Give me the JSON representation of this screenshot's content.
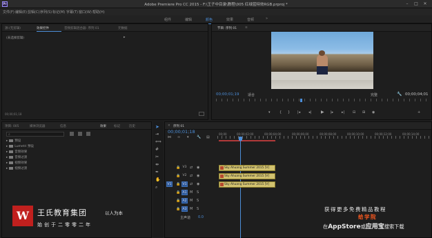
{
  "window": {
    "title": "Adobe Premiere Pro CC 2015 - F:\\王子中目录\\教程\\005 红绿蓝特效RGB.prproj *",
    "app_icon": "Pr"
  },
  "menubar": [
    "文件(F)",
    "编辑(E)",
    "剪辑(C)",
    "序列(S)",
    "标记(M)",
    "字幕(T)",
    "窗口(W)",
    "帮助(H)"
  ],
  "workspace": {
    "tabs": [
      "组件",
      "编辑",
      "颜色",
      "效果",
      "音频"
    ],
    "active_index": 2
  },
  "source_panel": {
    "tabs": [
      "源:(无剪辑)",
      "效果控件",
      "音频剪辑混合器: 序列 01",
      "元数据"
    ],
    "active_index": 1,
    "row_label": "(未选择剪辑)",
    "row_arrow": "▸"
  },
  "program_panel": {
    "tab": "节目: 序列 01",
    "menu_icon": "≡",
    "timecode_left": "00;00;01;19",
    "fit": "适合",
    "quality": "完整",
    "timecode_right": "00;00;04;01"
  },
  "project_panel": {
    "tabs": [
      "项目: 005",
      "媒体浏览器",
      "信息",
      "效果",
      "标记",
      "历史"
    ],
    "active_index": 3,
    "search_icon": "search-icon",
    "folders": [
      "预设",
      "Lumetri 预设",
      "音频效果",
      "音频过渡",
      "视频效果",
      "视频过渡"
    ]
  },
  "timeline": {
    "tab": "序列 01",
    "timecode": "00;00;01;18",
    "ruler": [
      "00;00",
      "00;00;02;00",
      "00;00;04;00",
      "00;00;06;00",
      "00;00;08;00",
      "00;00;10;00",
      "00;00;12;00",
      "00;00;14;00"
    ],
    "tracks": [
      {
        "toggle": "",
        "label": "V3",
        "targeted": false,
        "kind": "video"
      },
      {
        "toggle": "",
        "label": "V2",
        "targeted": false,
        "kind": "video"
      },
      {
        "toggle": "V1",
        "label": "V1",
        "targeted": true,
        "kind": "video"
      },
      {
        "toggle": "",
        "label": "A1",
        "targeted": true,
        "kind": "audio"
      },
      {
        "toggle": "",
        "label": "A2",
        "targeted": true,
        "kind": "audio"
      },
      {
        "toggle": "",
        "label": "A3",
        "targeted": true,
        "kind": "audio"
      }
    ],
    "master": {
      "label": "主声道",
      "value": "0.0"
    },
    "clips": [
      "Sky Ahuang Summer 2015 [V]",
      "Sky Ahuang Summer 2015 [V]",
      "Sky Ahuang Summer 2015 [V]"
    ],
    "accent_color": "#4c8ed9",
    "clip_color": "#d2c26f"
  },
  "watermark": {
    "logo_letter": "W",
    "name": "王氏教育集团",
    "slogan": "以人为本",
    "founded": "始创于二零零二年"
  },
  "promo": {
    "line1": "获得更多免费精品教程",
    "line2": "给学院",
    "line3_pre": "在",
    "line3_store": "AppStore",
    "line3_or": "或",
    "line3_app": "应用宝",
    "line3_post": "搜索下载"
  }
}
